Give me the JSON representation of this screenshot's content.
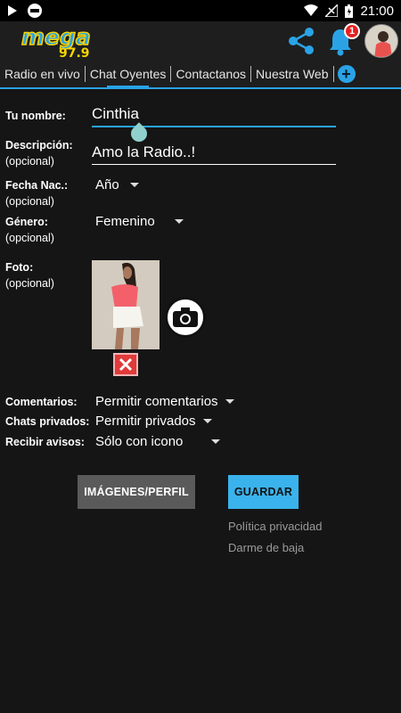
{
  "status_bar": {
    "time": "21:00"
  },
  "app": {
    "logo_main": "mega",
    "logo_sub": "97.9",
    "notification_count": "1",
    "accent_color": "#2aa3e6"
  },
  "tabs": [
    {
      "label": "Radio en vivo"
    },
    {
      "label": "Chat Oyentes"
    },
    {
      "label": "Contactanos"
    },
    {
      "label": "Nuestra Web"
    }
  ],
  "form": {
    "name_label": "Tu nombre:",
    "name_value": "Cinthia",
    "desc_label": "Descripción:",
    "desc_optional": "(opcional)",
    "desc_value": "Amo la Radio..!",
    "birth_label": "Fecha Nac.:",
    "birth_optional": "(opcional)",
    "birth_value": "Año",
    "gender_label": "Género:",
    "gender_optional": "(opcional)",
    "gender_value": "Femenino",
    "photo_label": "Foto:",
    "photo_optional": "(opcional)",
    "comments_label": "Comentarios:",
    "comments_value": "Permitir comentarios",
    "private_label": "Chats privados:",
    "private_value": "Permitir privados",
    "notify_label": "Recibir avisos:",
    "notify_value": "Sólo con icono"
  },
  "actions": {
    "images_profile": "IMÁGENES/PERFIL",
    "save": "GUARDAR",
    "privacy": "Política privacidad",
    "unsubscribe": "Darme de baja"
  }
}
